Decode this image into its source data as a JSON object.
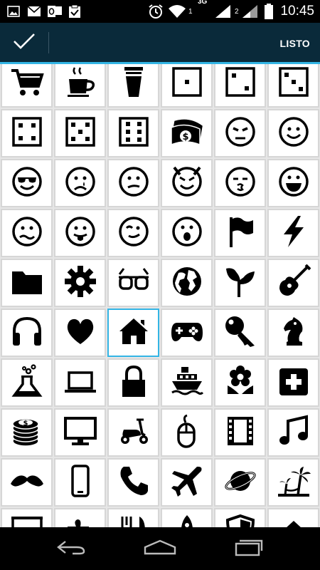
{
  "status_bar": {
    "time": "10:45",
    "network_type": "3G",
    "sim1": "1",
    "sim2": "2",
    "icons": [
      "image-icon",
      "mail-icon",
      "outlook-icon",
      "clipboard-check-icon",
      "alarm-icon",
      "wifi-icon",
      "signal-icon",
      "battery-icon"
    ]
  },
  "action_bar": {
    "done_label": "LISTO",
    "done_icon": "checkmark-icon",
    "accent_color": "#33b5e5",
    "background_color": "#0a2a3a"
  },
  "icon_grid": {
    "selected_icon": "home-icon",
    "icons": [
      "shopping-cart-icon",
      "coffee-cup-icon",
      "drink-cup-icon",
      "dice-one-icon",
      "dice-two-icon",
      "dice-three-icon",
      "dice-four-icon",
      "dice-five-icon",
      "dice-six-icon",
      "money-icon",
      "angry-face-icon",
      "smile-face-icon",
      "sunglasses-face-icon",
      "crying-face-icon",
      "confused-face-icon",
      "devil-face-icon",
      "kiss-face-icon",
      "laughing-face-icon",
      "worried-face-icon",
      "tongue-face-icon",
      "wink-face-icon",
      "surprised-face-icon",
      "flag-icon",
      "lightning-icon",
      "folder-icon",
      "gear-icon",
      "glasses-icon",
      "globe-icon",
      "sprout-icon",
      "guitar-icon",
      "headphones-icon",
      "heart-icon",
      "home-icon",
      "gamepad-icon",
      "key-icon",
      "chess-knight-icon",
      "flask-icon",
      "laptop-icon",
      "lock-icon",
      "ship-icon",
      "flower-icon",
      "first-aid-icon",
      "coins-icon",
      "monitor-icon",
      "scooter-icon",
      "mouse-icon",
      "film-icon",
      "music-note-icon",
      "mustache-icon",
      "smartphone-icon",
      "phone-icon",
      "airplane-icon",
      "planet-icon",
      "beach-icon",
      "easel-icon",
      "puzzle-icon",
      "cutlery-icon",
      "rocket-icon",
      "shield-icon",
      "hat-icon"
    ]
  },
  "nav_bar": {
    "buttons": [
      "back-icon",
      "home-nav-icon",
      "recents-icon"
    ]
  }
}
